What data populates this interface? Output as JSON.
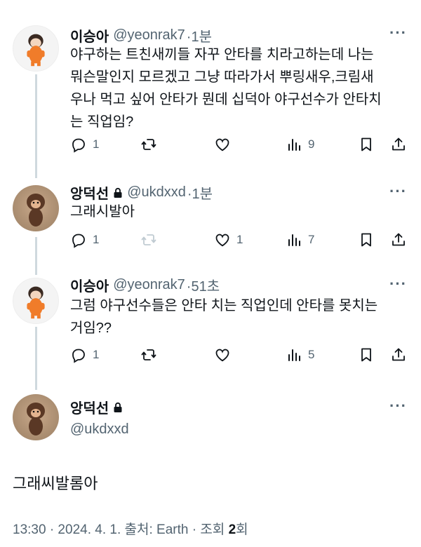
{
  "tweets": [
    {
      "name": "이승아",
      "handle": "@yeonrak7",
      "time": "·1분",
      "lines": [
        "야구하는 트친새끼들 자꾸 안타를 치라고하는데 나는",
        "뭐슨말인지 모르겠고 그냥 따라가서 뿌링새우,크림새",
        "우나 먹고 싶어 안타가 뭔데 십덕아 야구선수가 안타치",
        "는 직업임?"
      ],
      "reply_count": "1",
      "retweet_count": "",
      "like_count": "",
      "view_count": "9"
    },
    {
      "name": "앙덕선",
      "handle": "@ukdxxd",
      "time": "·1분",
      "lines": [
        "그래시발아"
      ],
      "reply_count": "1",
      "retweet_count": "",
      "like_count": "1",
      "view_count": "7"
    },
    {
      "name": "이승아",
      "handle": "@yeonrak7",
      "time": "·51초",
      "lines": [
        "그럼 야구선수들은 안타 치는 직업인데 안타를 못치는",
        "거임??"
      ],
      "reply_count": "1",
      "retweet_count": "",
      "like_count": "",
      "view_count": "5"
    }
  ],
  "main_tweet": {
    "name": "앙덕선",
    "handle": "@ukdxxd",
    "text": "그래씨발롬아",
    "meta_prefix": "13:30 · 2024. 4. 1. 출처: Earth · 조회 ",
    "views": "2",
    "views_suffix": "회"
  },
  "more_label": "···",
  "icons": [
    "reply-icon",
    "retweet-icon",
    "like-icon",
    "views-icon",
    "bookmark-icon",
    "share-icon",
    "lock-icon",
    "more-icon"
  ],
  "colors": {
    "text": "#0f1419",
    "muted": "#536471",
    "thread_line": "#cfd9de",
    "retweet_disabled": "#c0cbd2"
  }
}
